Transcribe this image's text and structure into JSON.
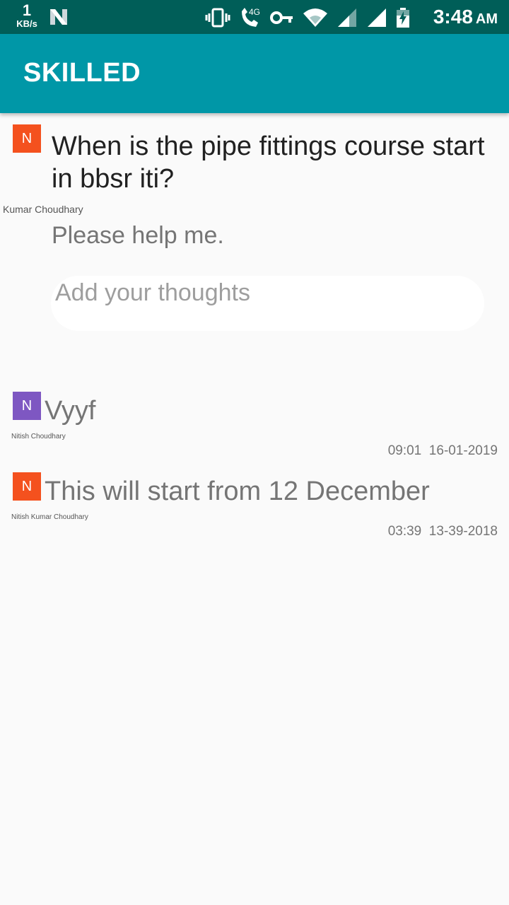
{
  "status_bar": {
    "net_speed": "1",
    "net_unit": "KB/s",
    "network_type": "4G",
    "time": "3:48",
    "ampm": "AM",
    "icons": [
      "n-notification-icon",
      "vibrate-icon",
      "wifi-calling-icon",
      "vpn-key-icon",
      "wifi-icon",
      "signal-icon",
      "signal-icon-2",
      "battery-charging-icon"
    ]
  },
  "app_bar": {
    "title": "SKILLED"
  },
  "question": {
    "avatar_letter": "N",
    "avatar_color": "#f4511e",
    "title": "When is the pipe fittings course start in bbsr iti?",
    "title_line1": "When is the pipe fittings course start",
    "title_line2": "in bbsr iti?",
    "author": "Kumar Choudhary",
    "body": "Please help me."
  },
  "compose": {
    "placeholder": "Add your thoughts"
  },
  "answers": [
    {
      "avatar_letter": "N",
      "avatar_color": "#7e57c2",
      "text": "Vyyf",
      "author": "Nitish Choudhary",
      "time": "09:01",
      "date": "16-01-2019",
      "timestamp": "09:01  16-01-2019"
    },
    {
      "avatar_letter": "N",
      "avatar_color": "#f4511e",
      "text": "This will start from 12 December",
      "author": "Nitish Kumar Choudhary",
      "time": "03:39",
      "date": "13-39-2018",
      "timestamp": "03:39  13-39-2018"
    }
  ],
  "colors": {
    "status_bar": "#005e58",
    "app_bar": "#0097a7",
    "background": "#fafafa"
  }
}
